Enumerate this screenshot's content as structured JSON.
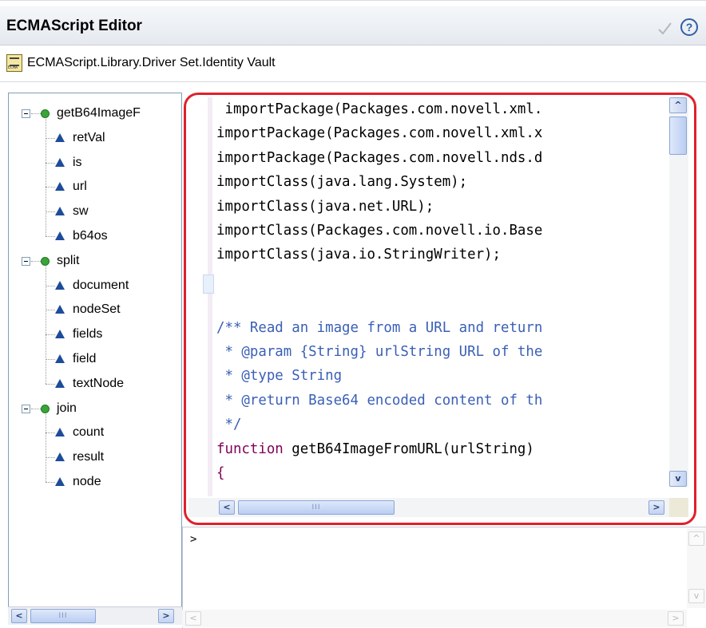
{
  "header": {
    "title": "ECMAScript Editor",
    "check_icon": "check-icon",
    "help_icon": "help-icon",
    "help_glyph": "?"
  },
  "subheader": {
    "icon": "ecma-file-icon",
    "icon_text": "ECMA",
    "path": "ECMAScript.Library.Driver Set.Identity Vault"
  },
  "tree": {
    "functions": [
      {
        "name": "getB64ImageF",
        "variables": [
          "retVal",
          "is",
          "url",
          "sw",
          "b64os"
        ]
      },
      {
        "name": "split",
        "variables": [
          "document",
          "nodeSet",
          "fields",
          "field",
          "textNode"
        ]
      },
      {
        "name": "join",
        "variables": [
          "count",
          "result",
          "node"
        ]
      }
    ]
  },
  "editor": {
    "lines": [
      {
        "text": " importPackage(Packages.com.novell.xml.",
        "kind": "plain"
      },
      {
        "text": "importPackage(Packages.com.novell.xml.x",
        "kind": "plain"
      },
      {
        "text": "importPackage(Packages.com.novell.nds.d",
        "kind": "plain"
      },
      {
        "text": "importClass(java.lang.System);",
        "kind": "plain"
      },
      {
        "text": "importClass(java.net.URL);",
        "kind": "plain"
      },
      {
        "text": "importClass(Packages.com.novell.io.Base",
        "kind": "plain"
      },
      {
        "text": "importClass(java.io.StringWriter);",
        "kind": "plain"
      },
      {
        "text": "",
        "kind": "plain"
      },
      {
        "text": "",
        "kind": "plain"
      },
      {
        "text": "/** Read an image from a URL and return",
        "kind": "comment"
      },
      {
        "text": " * @param {String} urlString URL of the",
        "kind": "comment"
      },
      {
        "text": " * @type String",
        "kind": "comment"
      },
      {
        "text": " * @return Base64 encoded content of th",
        "kind": "comment"
      },
      {
        "text": " */",
        "kind": "comment"
      },
      {
        "text": "function getB64ImageFromURL(urlString)",
        "kind": "function"
      },
      {
        "text": "{",
        "kind": "keyword"
      }
    ]
  },
  "console": {
    "prompt": ">"
  },
  "scroll": {
    "left": "<",
    "right": ">",
    "up": "^",
    "down": "v",
    "grip": "III"
  },
  "colors": {
    "highlight_outline": "#e0202a",
    "comment": "#3a5fb6",
    "keyword": "#7f0055",
    "function_dot": "#3aa33a",
    "variable_triangle": "#1d4c9a"
  }
}
